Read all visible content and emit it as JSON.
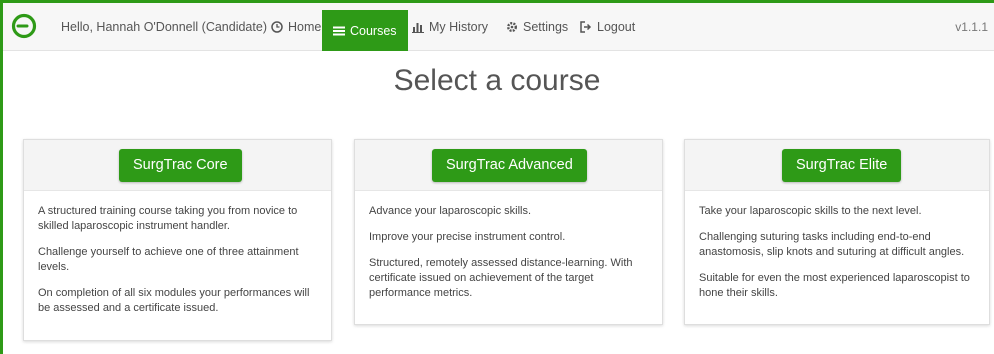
{
  "colors": {
    "brand": "#2e9a17",
    "navbar_bg": "#f7f7f7"
  },
  "navbar": {
    "logo_icon": "ring-logo-icon",
    "greeting": "Hello, Hannah O'Donnell (Candidate)",
    "items": [
      {
        "label": "Home",
        "icon": "clock-icon"
      },
      {
        "label": "Courses",
        "icon": "list-icon",
        "active": true
      },
      {
        "label": "My History",
        "icon": "bar-chart-icon"
      },
      {
        "label": "Settings",
        "icon": "gear-icon"
      },
      {
        "label": "Logout",
        "icon": "logout-icon"
      }
    ],
    "version": "v1.1.1"
  },
  "page_title": "Select a course",
  "courses": [
    {
      "button": "SurgTrac Core",
      "paragraphs": [
        "A structured training course taking you from novice to skilled laparoscopic instrument handler.",
        "Challenge yourself to achieve one of three attainment levels.",
        "On completion of all six modules your performances will be assessed and a certificate issued."
      ]
    },
    {
      "button": "SurgTrac Advanced",
      "paragraphs": [
        "Advance your laparoscopic skills.",
        "Improve your precise instrument control.",
        "Structured, remotely assessed distance-learning. With certificate issued on achievement of the target performance metrics."
      ]
    },
    {
      "button": "SurgTrac Elite",
      "paragraphs": [
        "Take your laparoscopic skills to the next level.",
        "Challenging suturing tasks including end-to-end anastomosis, slip knots and suturing at difficult angles.",
        "Suitable for even the most experienced laparoscopist to hone their skills."
      ]
    }
  ]
}
